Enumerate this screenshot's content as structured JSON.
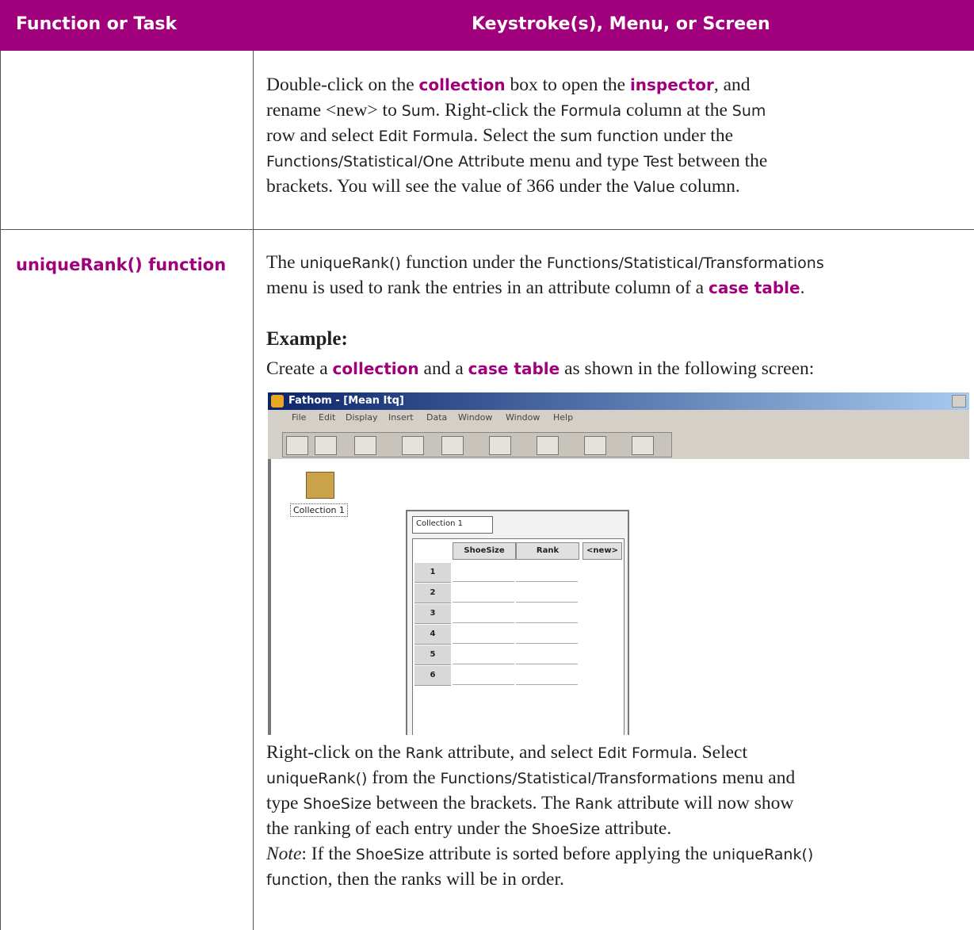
{
  "header": {
    "col1": "Function or Task",
    "col2": "Keystroke(s), Menu, or Screen"
  },
  "row1": {
    "line1_a": "Double-click on the ",
    "line1_b": "collection",
    "line1_c": " box to open the ",
    "line1_d": "inspector",
    "line1_e": ", and",
    "line2_a": "rename <new> to ",
    "line2_b": "Sum",
    "line2_c": ". Right-click the ",
    "line2_d": "Formula",
    "line2_e": " column at the ",
    "line2_f": "Sum",
    "line3_a": "row and select ",
    "line3_b": "Edit Formula",
    "line3_c": ". Select the ",
    "line3_d": "sum function",
    "line3_e": " under the",
    "line4_a": "Functions/Statistical/One Attribute",
    "line4_b": " menu and type ",
    "line4_c": "Test",
    "line4_d": " between the",
    "line5_a": "brackets. You will see the value of 366 under the ",
    "line5_b": "Value",
    "line5_c": " column."
  },
  "row2": {
    "label": "uniqueRank() function",
    "p1_a": "The ",
    "p1_b": "uniqueRank()",
    "p1_c": " function under the ",
    "p1_d": "Functions/Statistical/Transformations",
    "p1_e": "menu is used to rank the entries in an attribute column of a ",
    "p1_f": "case table",
    "p1_g": ".",
    "example_heading": "Example:",
    "p2_a": "Create a ",
    "p2_b": "collection",
    "p2_c": " and a ",
    "p2_d": "case table",
    "p2_e": " as shown in the following screen:",
    "p3_a": "Right-click on the ",
    "p3_b": "Rank",
    "p3_c": " attribute, and select ",
    "p3_d": "Edit Formula",
    "p3_e": ". Select",
    "p3_f": "uniqueRank()",
    "p3_g": " from the ",
    "p3_h": "Functions/Statistical/Transformations",
    "p3_i": " menu and",
    "p3_j": "type ",
    "p3_k": "ShoeSize",
    "p3_l": " between the brackets. The ",
    "p3_m": "Rank",
    "p3_n": " attribute will now show",
    "p3_o": "the ranking of each entry under the ",
    "p3_p": "ShoeSize",
    "p3_q": " attribute.",
    "note_label": "Note",
    "note_a": ": If the ",
    "note_b": "ShoeSize",
    "note_c": " attribute is sorted before applying the ",
    "note_d": "uniqueRank()",
    "note_e": "function",
    "note_f": ", then the ranks will be in order."
  },
  "screenshot": {
    "window_title": "Fathom - [Mean Itq]",
    "menus": [
      "File",
      "Edit",
      "Display",
      "Insert",
      "Data",
      "Window",
      "Window",
      "Help"
    ],
    "collection_label": "Collection 1",
    "table_tab": "Collection 1",
    "columns": [
      "ShoeSize",
      "Rank",
      "<new>"
    ],
    "rows": [
      "1",
      "2",
      "3",
      "4",
      "5",
      "6"
    ]
  }
}
